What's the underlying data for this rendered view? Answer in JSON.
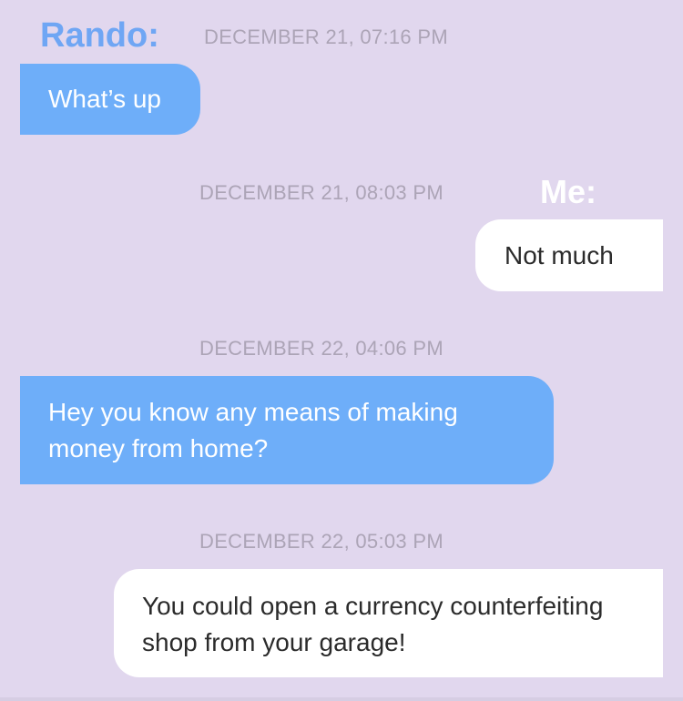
{
  "colors": {
    "background": "#e1d7ee",
    "incoming_bubble": "#6eaef9",
    "outgoing_bubble": "#ffffff",
    "timestamp": "#aca4b6",
    "rando_label": "#6fa6f4",
    "me_label": "#ffffff"
  },
  "labels": {
    "rando": "Rando:",
    "me": "Me:"
  },
  "messages": [
    {
      "direction": "incoming",
      "timestamp": "DECEMBER 21, 07:16 PM",
      "text": "What’s up"
    },
    {
      "direction": "outgoing",
      "timestamp": "DECEMBER 21, 08:03 PM",
      "text": "Not much"
    },
    {
      "direction": "incoming",
      "timestamp": "DECEMBER 22, 04:06 PM",
      "text": "Hey you know any means of making money from home?"
    },
    {
      "direction": "outgoing",
      "timestamp": "DECEMBER 22, 05:03 PM",
      "text": "You could open a currency counterfeiting shop from your garage!"
    }
  ]
}
